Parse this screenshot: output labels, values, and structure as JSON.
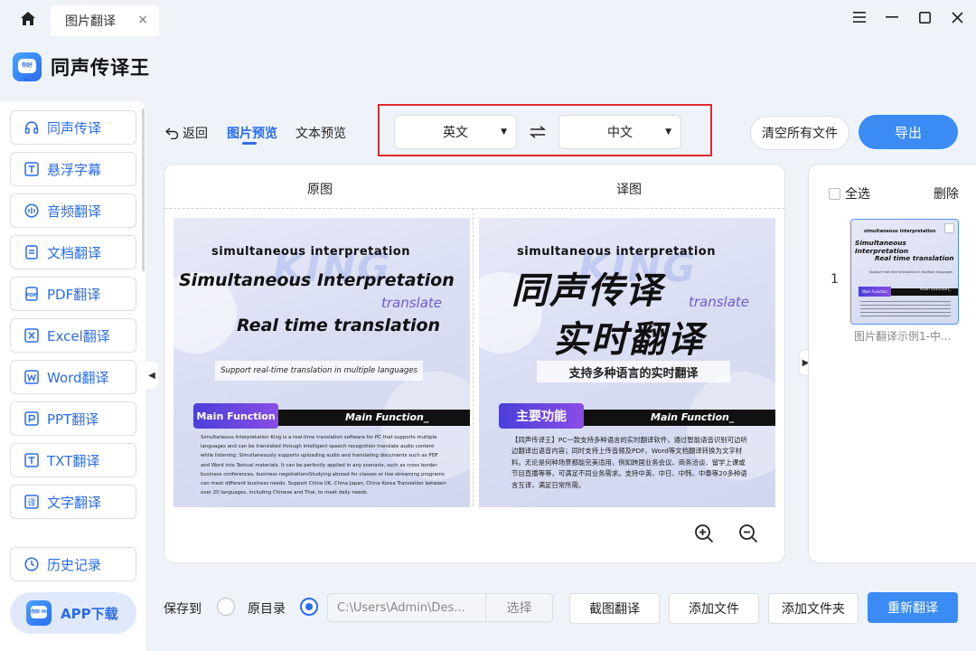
{
  "titlebar": {
    "tab_label": "图片翻译",
    "tab_close": "×"
  },
  "brand": {
    "name": "同声传译王",
    "logo_text": "你好 Hi"
  },
  "sidebar": {
    "items": [
      {
        "label": "同声传译",
        "icon": "headphones-icon"
      },
      {
        "label": "悬浮字幕",
        "icon": "subtitle-icon"
      },
      {
        "label": "音频翻译",
        "icon": "audio-icon"
      },
      {
        "label": "文档翻译",
        "icon": "document-icon"
      },
      {
        "label": "PDF翻译",
        "icon": "pdf-icon"
      },
      {
        "label": "Excel翻译",
        "icon": "excel-icon"
      },
      {
        "label": "Word翻译",
        "icon": "word-icon"
      },
      {
        "label": "PPT翻译",
        "icon": "ppt-icon"
      },
      {
        "label": "TXT翻译",
        "icon": "txt-icon"
      },
      {
        "label": "文字翻译",
        "icon": "text-translate-icon"
      }
    ],
    "history_label": "历史记录",
    "app_download_label": "APP下载"
  },
  "toolbar": {
    "back_label": "返回",
    "image_preview_label": "图片预览",
    "text_preview_label": "文本预览",
    "source_lang": "英文",
    "target_lang": "中文",
    "clear_label": "清空所有文件",
    "export_label": "导出"
  },
  "preview": {
    "original_header": "原图",
    "translated_header": "译图",
    "original": {
      "watermark": "KING",
      "subtitle": "simultaneous interpretation",
      "title": "Simultaneous Interpretation",
      "translate_word": "translate",
      "realtime": "Real time translation",
      "support": "Support real-time translation in multiple languages",
      "func_tag": "Main Function",
      "func_en": "Main Function_",
      "description": "Simultaneous Interpretation King is a real-time translation software for PC that supports multiple languages and can be translated through intelligent speech recognition translate audio content while listening; Simultaneously supports uploading audio and translating documents such as PDF and Word into Textual materials. It can be perfectly applied in any scenario, such as cross border business conferences, business negotiationsStudying abroad for classes or live streaming programs can meet different business needs. Support China UK, China Japan, China Korea Translation between over 20 languages, including Chinese and Thai, to meet daily needs."
    },
    "translated": {
      "watermark": "KING",
      "subtitle": "simultaneous interpretation",
      "title": "同声传译",
      "translate_word": "translate",
      "realtime": "实时翻译",
      "support": "支持多种语言的实时翻译",
      "func_tag": "主要功能",
      "func_en": "Main Function_",
      "description": "【同声传译王】PC一款支持多种语言的实时翻译软件，通过智能语音识别可边听边翻译出语音内容；同时支持上传音频及PDF、Word等文档翻译转换为文字材料。无论是何种场景都能完美适用，例如跨国业务会议、商务洽谈、留学上课或节目直播等等，可满足不同业务需求。支持中英、中日、中韩、中泰等20多种语言互译，满足日常所需。"
    }
  },
  "files": {
    "select_all_label": "全选",
    "delete_label": "删除",
    "items": [
      {
        "index": "1",
        "name": "图片翻译示例1-中...",
        "thumb_subtitle": "simultaneous interpretation",
        "thumb_title": "Simultaneous Interpretation",
        "thumb_realtime": "Real time translation",
        "thumb_support": "Support real-time translation in multiple languages",
        "thumb_tag": "Main Function",
        "thumb_func": "Main Function_"
      }
    ]
  },
  "bottom": {
    "save_to_label": "保存到",
    "original_dir_label": "原目录",
    "path_value": "C:\\Users\\Admin\\Des...",
    "choose_label": "选择",
    "screenshot_label": "截图翻译",
    "add_file_label": "添加文件",
    "add_folder_label": "添加文件夹",
    "retranslate_label": "重新翻译"
  },
  "colors": {
    "accent": "#2a6cf0",
    "primary_button": "#3b8bf5",
    "highlight_frame": "#e0282e"
  }
}
